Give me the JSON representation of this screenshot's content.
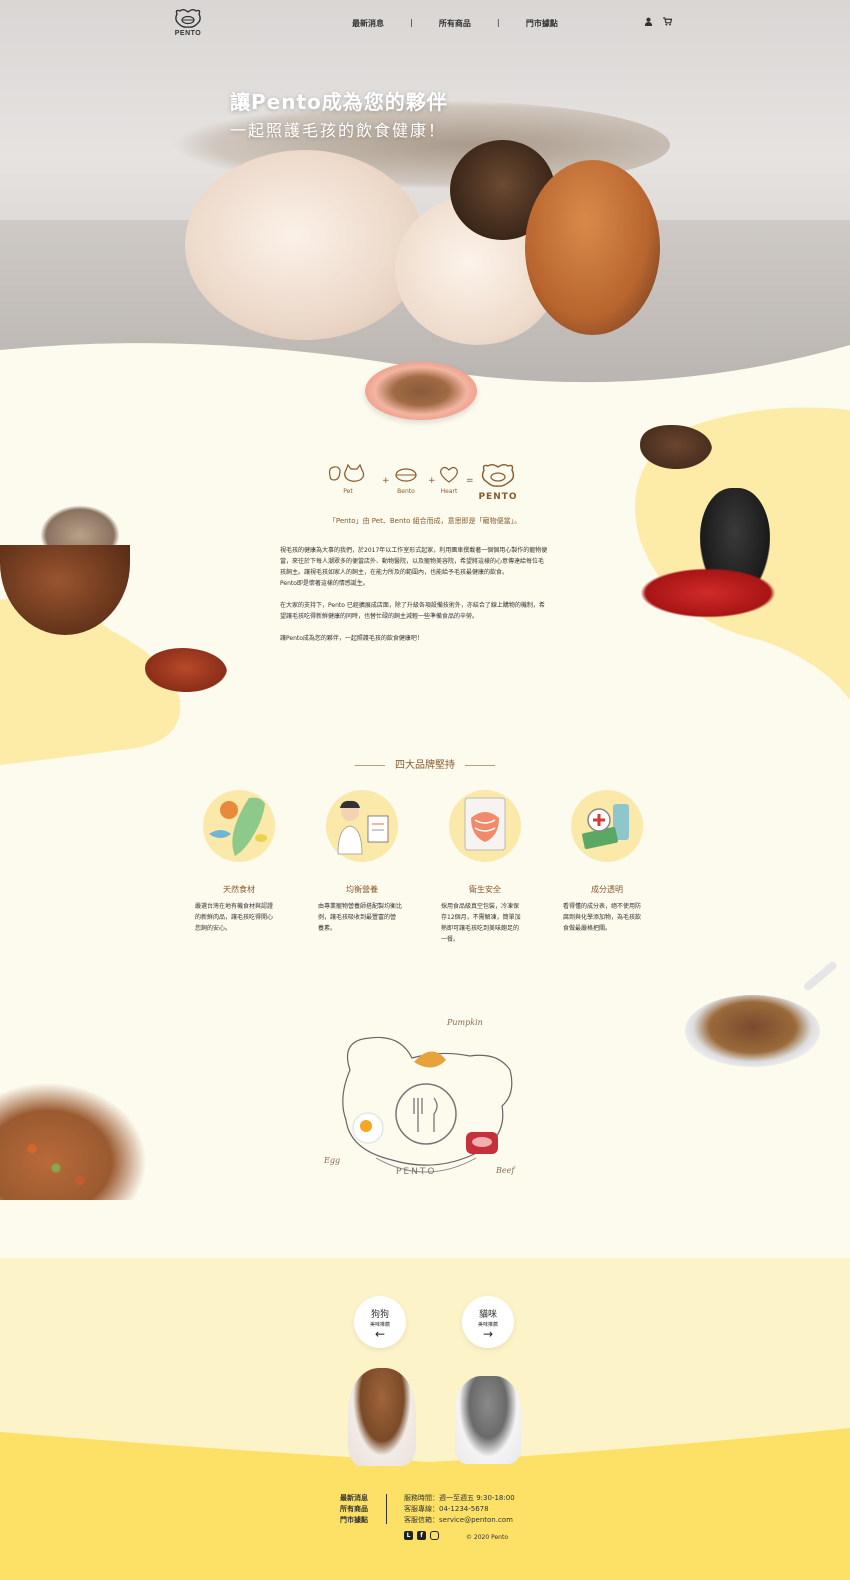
{
  "nav": {
    "logo_text": "PENTO",
    "links": [
      "最新消息",
      "所有商品",
      "門市據點"
    ],
    "user_icon": "user-icon",
    "cart_icon": "cart-icon"
  },
  "hero": {
    "line1": "讓Pento成為您的夥伴",
    "line2": "一起照護毛孩的飲食健康！"
  },
  "formula": {
    "pet": "Pet",
    "bento": "Bento",
    "heart": "Heart",
    "result": "PENTO",
    "plus": "+",
    "equals": "="
  },
  "intro": {
    "tagline": "「Pento」由 Pet、Bento 組合而成，意思即是「寵物便當」。",
    "p1_l1": "視毛孩的健康為大事的我們，於2017年以工作室形式起家，利用團車撰載著一個個用心製作的寵物便",
    "p1_l2": "當，來往於下每人潮眾多的便當店外、動物醫院，以及寵物美容院，希望將這樣的心意傳達給每位毛",
    "p1_l3": "孩飼主。讓視毛孩如家人的飼主，在能力所及的範圍內，也能給予毛孩最健康的飲食。",
    "p1_l4": "Pento即是懷著這樣的情感誕生。",
    "p2_l1": "在大家的支持下，Pento 已經擴展成店面，除了升級各項設備技術外，亦結合了線上購物的機制，希",
    "p2_l2": "望讓毛孩吃得新鮮健康的同時，也替忙碌的飼主減輕一些準備食品的辛勞。",
    "p3": "讓Pento成為您的夥伴，一起照護毛孩的飲食健康吧！"
  },
  "features": {
    "heading": "四大品牌堅持",
    "items": [
      {
        "title": "天然食材",
        "desc": [
          "嚴選台灣在地有機食材與認證",
          "的新鮮肉品，讓毛孩吃得開心",
          "您飼的安心。"
        ]
      },
      {
        "title": "均衡營養",
        "desc": [
          "由專業寵物營養師搭配製均衡比",
          "例，讓毛孩吸收到最豐富的營",
          "養素。"
        ]
      },
      {
        "title": "衛生安全",
        "desc": [
          "採用食品級真空包裝，冷凍保",
          "存12個月，不需解凍，簡單加",
          "熱即可讓毛孩吃到美味飽足的",
          "一餐。"
        ]
      },
      {
        "title": "成分透明",
        "desc": [
          "看得懂的成分表，絕不使用防",
          "腐劑與化學添加物，為毛孩飲",
          "食做最嚴格把關。"
        ]
      }
    ]
  },
  "diagram": {
    "pumpkin": "Pumpkin",
    "egg": "Egg",
    "beef": "Beef",
    "brand": "PENTO"
  },
  "choose": {
    "dog_title": "狗狗",
    "dog_sub": "美味推薦",
    "dog_arrow": "←",
    "cat_title": "貓咪",
    "cat_sub": "美味推薦",
    "cat_arrow": "→"
  },
  "footer": {
    "links": [
      "最新消息",
      "所有商品",
      "門市據點"
    ],
    "hours": "服務時間：週一至週五 9:30-18:00",
    "phone": "客服專線：04-1234-5678",
    "email": "客服信箱：service@penton.com",
    "copyright": "© 2020 Pento",
    "social": [
      "line-icon",
      "facebook-icon",
      "instagram-icon"
    ]
  },
  "colors": {
    "cream": "#fdfaee",
    "yellow_blob": "#fdeca8",
    "footer_yellow": "#fde066",
    "brown_text": "#8a5a2e"
  }
}
